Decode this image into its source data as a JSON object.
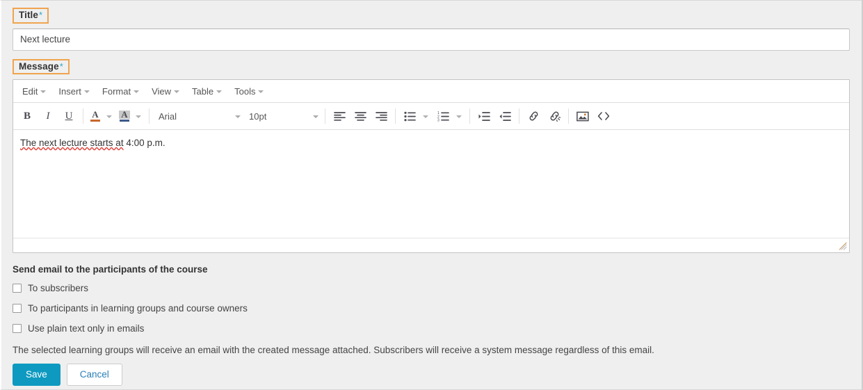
{
  "form": {
    "title_field": {
      "label": "Title",
      "required_marker": "*",
      "value": "Next lecture"
    },
    "message_field": {
      "label": "Message",
      "required_marker": "*"
    }
  },
  "editor": {
    "menubar": [
      {
        "label": "Edit",
        "icon": "chevron-down-icon"
      },
      {
        "label": "Insert",
        "icon": "chevron-down-icon"
      },
      {
        "label": "Format",
        "icon": "chevron-down-icon"
      },
      {
        "label": "View",
        "icon": "chevron-down-icon"
      },
      {
        "label": "Table",
        "icon": "chevron-down-icon"
      },
      {
        "label": "Tools",
        "icon": "chevron-down-icon"
      }
    ],
    "toolbar": {
      "bold": {
        "glyph": "B",
        "name": "bold-icon"
      },
      "italic": {
        "glyph": "I",
        "name": "italic-icon"
      },
      "underline": {
        "glyph": "U",
        "name": "underline-icon"
      },
      "text_color": {
        "glyph": "A",
        "name": "text-color-icon",
        "swatch": "#c8672b"
      },
      "background_color": {
        "glyph": "A",
        "name": "background-color-icon",
        "swatch": "#3e5a8a"
      },
      "font_family": {
        "value": "Arial",
        "name": "font-family-select"
      },
      "font_size": {
        "value": "10pt",
        "name": "font-size-select"
      },
      "align_left": "align-left-icon",
      "align_center": "align-center-icon",
      "align_right": "align-right-icon",
      "bullet_list": "bullet-list-icon",
      "numbered_list": "numbered-list-icon",
      "indent": "indent-icon",
      "outdent": "outdent-icon",
      "link": "link-icon",
      "unlink": "unlink-icon",
      "image": "image-icon",
      "source_code": "source-code-icon"
    },
    "content": {
      "misspelled_part": "The next lecture starts at",
      "rest_part": " 4:00 p.m."
    }
  },
  "email_section": {
    "heading": "Send email to the participants of the course",
    "checkboxes": [
      {
        "label": "To subscribers",
        "checked": false
      },
      {
        "label": "To participants in learning groups and course owners",
        "checked": false
      },
      {
        "label": "Use plain text only in emails",
        "checked": false
      }
    ],
    "note": "The selected learning groups will receive an email with the created message attached. Subscribers will receive a system message regardless of this email."
  },
  "actions": {
    "save_label": "Save",
    "cancel_label": "Cancel"
  },
  "colors": {
    "accent": "#0e9ac0",
    "highlight_border": "#f0a44e",
    "required_star": "#2aa8c9",
    "link_text": "#2b7fb5",
    "page_bg": "#efefef"
  }
}
